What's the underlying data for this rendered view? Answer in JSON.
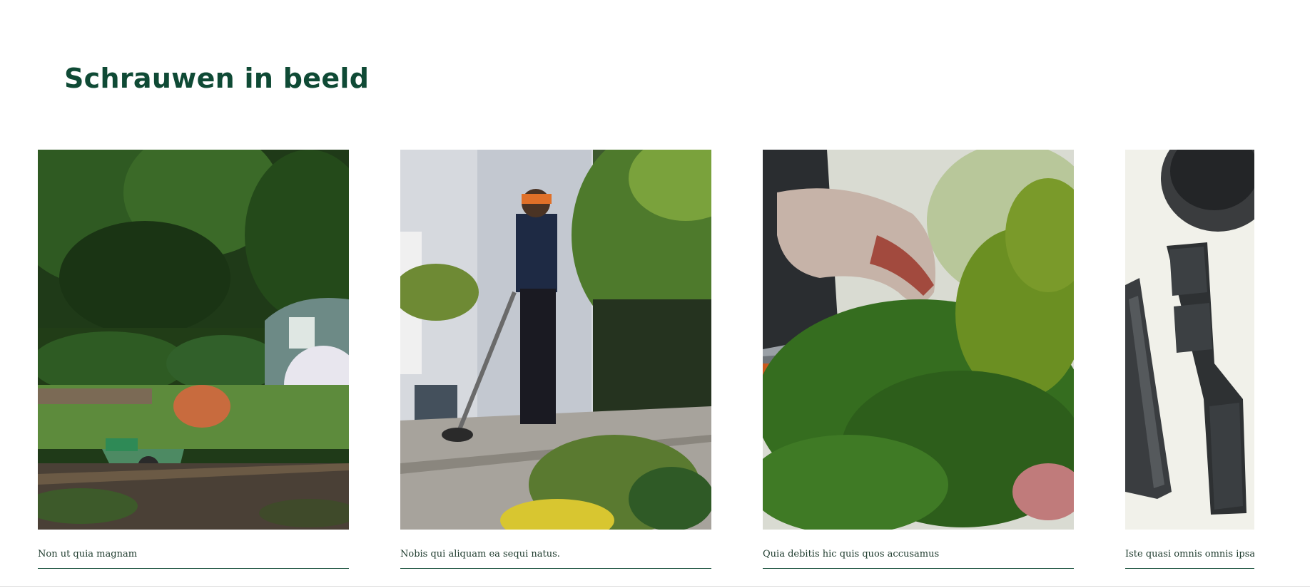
{
  "section": {
    "title": "Schrauwen in beeld"
  },
  "gallery": {
    "items": [
      {
        "caption": "Non ut quia magnam",
        "image": "garden-wheelbarrow-photo"
      },
      {
        "caption": "Nobis qui aliquam ea sequi natus.",
        "image": "gardener-trimmer-photo"
      },
      {
        "caption": "Quia debitis hic quis quos accusamus",
        "image": "pruning-shears-photo"
      },
      {
        "caption": "Iste quasi omnis omnis ipsa.",
        "image": "plant-pots-photo"
      }
    ]
  },
  "colors": {
    "brand_green": "#0f4a35",
    "caption_text": "#1d3a2c",
    "background": "#ffffff"
  }
}
